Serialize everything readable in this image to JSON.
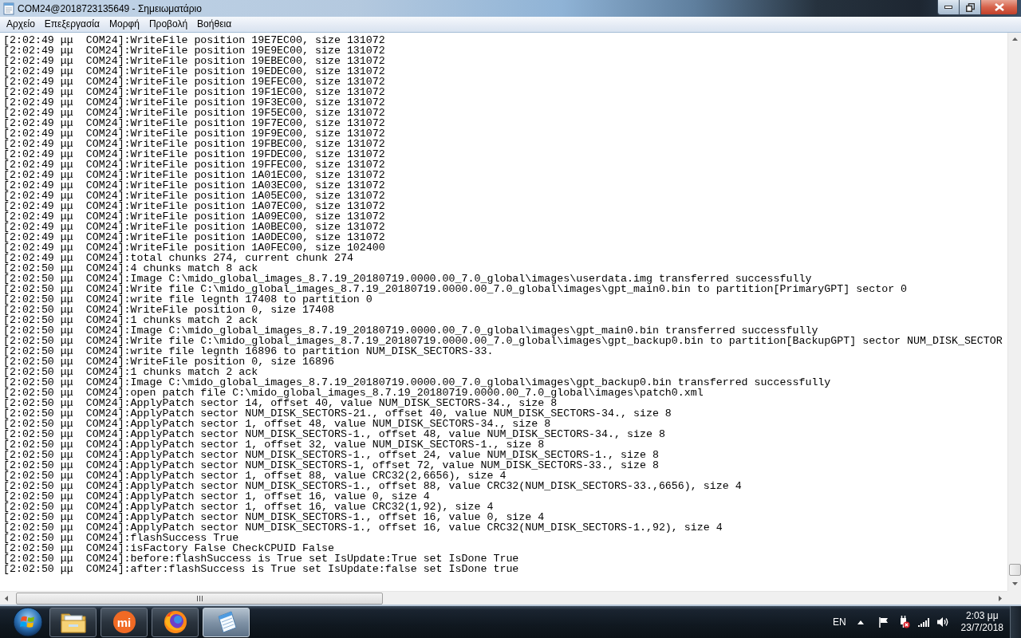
{
  "window": {
    "title": "COM24@2018723135649 - Σημειωματάριο"
  },
  "menu": [
    "Αρχείο",
    "Επεξεργασία",
    "Μορφή",
    "Προβολή",
    "Βοήθεια"
  ],
  "editor": {
    "lines": [
      "[2:02:49 μμ  COM24]:WriteFile position 19E7EC00, size 131072",
      "[2:02:49 μμ  COM24]:WriteFile position 19E9EC00, size 131072",
      "[2:02:49 μμ  COM24]:WriteFile position 19EBEC00, size 131072",
      "[2:02:49 μμ  COM24]:WriteFile position 19EDEC00, size 131072",
      "[2:02:49 μμ  COM24]:WriteFile position 19EFEC00, size 131072",
      "[2:02:49 μμ  COM24]:WriteFile position 19F1EC00, size 131072",
      "[2:02:49 μμ  COM24]:WriteFile position 19F3EC00, size 131072",
      "[2:02:49 μμ  COM24]:WriteFile position 19F5EC00, size 131072",
      "[2:02:49 μμ  COM24]:WriteFile position 19F7EC00, size 131072",
      "[2:02:49 μμ  COM24]:WriteFile position 19F9EC00, size 131072",
      "[2:02:49 μμ  COM24]:WriteFile position 19FBEC00, size 131072",
      "[2:02:49 μμ  COM24]:WriteFile position 19FDEC00, size 131072",
      "[2:02:49 μμ  COM24]:WriteFile position 19FFEC00, size 131072",
      "[2:02:49 μμ  COM24]:WriteFile position 1A01EC00, size 131072",
      "[2:02:49 μμ  COM24]:WriteFile position 1A03EC00, size 131072",
      "[2:02:49 μμ  COM24]:WriteFile position 1A05EC00, size 131072",
      "[2:02:49 μμ  COM24]:WriteFile position 1A07EC00, size 131072",
      "[2:02:49 μμ  COM24]:WriteFile position 1A09EC00, size 131072",
      "[2:02:49 μμ  COM24]:WriteFile position 1A0BEC00, size 131072",
      "[2:02:49 μμ  COM24]:WriteFile position 1A0DEC00, size 131072",
      "[2:02:49 μμ  COM24]:WriteFile position 1A0FEC00, size 102400",
      "[2:02:49 μμ  COM24]:total chunks 274, current chunk 274",
      "[2:02:50 μμ  COM24]:4 chunks match 8 ack",
      "[2:02:50 μμ  COM24]:Image C:\\mido_global_images_8.7.19_20180719.0000.00_7.0_global\\images\\userdata.img transferred successfully",
      "[2:02:50 μμ  COM24]:Write file C:\\mido_global_images_8.7.19_20180719.0000.00_7.0_global\\images\\gpt_main0.bin to partition[PrimaryGPT] sector 0",
      "[2:02:50 μμ  COM24]:write file legnth 17408 to partition 0",
      "[2:02:50 μμ  COM24]:WriteFile position 0, size 17408",
      "[2:02:50 μμ  COM24]:1 chunks match 2 ack",
      "[2:02:50 μμ  COM24]:Image C:\\mido_global_images_8.7.19_20180719.0000.00_7.0_global\\images\\gpt_main0.bin transferred successfully",
      "[2:02:50 μμ  COM24]:Write file C:\\mido_global_images_8.7.19_20180719.0000.00_7.0_global\\images\\gpt_backup0.bin to partition[BackupGPT] sector NUM_DISK_SECTOR",
      "[2:02:50 μμ  COM24]:write file legnth 16896 to partition NUM_DISK_SECTORS-33.",
      "[2:02:50 μμ  COM24]:WriteFile position 0, size 16896",
      "[2:02:50 μμ  COM24]:1 chunks match 2 ack",
      "[2:02:50 μμ  COM24]:Image C:\\mido_global_images_8.7.19_20180719.0000.00_7.0_global\\images\\gpt_backup0.bin transferred successfully",
      "[2:02:50 μμ  COM24]:open patch file C:\\mido_global_images_8.7.19_20180719.0000.00_7.0_global\\images\\patch0.xml",
      "[2:02:50 μμ  COM24]:ApplyPatch sector 14, offset 40, value NUM_DISK_SECTORS-34., size 8",
      "[2:02:50 μμ  COM24]:ApplyPatch sector NUM_DISK_SECTORS-21., offset 40, value NUM_DISK_SECTORS-34., size 8",
      "[2:02:50 μμ  COM24]:ApplyPatch sector 1, offset 48, value NUM_DISK_SECTORS-34., size 8",
      "[2:02:50 μμ  COM24]:ApplyPatch sector NUM_DISK_SECTORS-1., offset 48, value NUM_DISK_SECTORS-34., size 8",
      "[2:02:50 μμ  COM24]:ApplyPatch sector 1, offset 32, value NUM_DISK_SECTORS-1., size 8",
      "[2:02:50 μμ  COM24]:ApplyPatch sector NUM_DISK_SECTORS-1., offset 24, value NUM_DISK_SECTORS-1., size 8",
      "[2:02:50 μμ  COM24]:ApplyPatch sector NUM_DISK_SECTORS-1, offset 72, value NUM_DISK_SECTORS-33., size 8",
      "[2:02:50 μμ  COM24]:ApplyPatch sector 1, offset 88, value CRC32(2,6656), size 4",
      "[2:02:50 μμ  COM24]:ApplyPatch sector NUM_DISK_SECTORS-1., offset 88, value CRC32(NUM_DISK_SECTORS-33.,6656), size 4",
      "[2:02:50 μμ  COM24]:ApplyPatch sector 1, offset 16, value 0, size 4",
      "[2:02:50 μμ  COM24]:ApplyPatch sector 1, offset 16, value CRC32(1,92), size 4",
      "[2:02:50 μμ  COM24]:ApplyPatch sector NUM_DISK_SECTORS-1., offset 16, value 0, size 4",
      "[2:02:50 μμ  COM24]:ApplyPatch sector NUM_DISK_SECTORS-1., offset 16, value CRC32(NUM_DISK_SECTORS-1.,92), size 4",
      "[2:02:50 μμ  COM24]:flashSuccess True",
      "[2:02:50 μμ  COM24]:isFactory False CheckCPUID False",
      "[2:02:50 μμ  COM24]:before:flashSuccess is True set IsUpdate:True set IsDone True",
      "[2:02:50 μμ  COM24]:after:flashSuccess is True set IsUpdate:false set IsDone true"
    ]
  },
  "taskbar": {
    "apps": [
      {
        "kind": "folder",
        "active": false
      },
      {
        "kind": "logo",
        "label": "mi",
        "active": false
      },
      {
        "kind": "browser",
        "active": false
      },
      {
        "kind": "notepad",
        "active": true
      }
    ],
    "language": "EN",
    "clock": {
      "time": "2:03 μμ",
      "date": "23/7/2018"
    }
  }
}
